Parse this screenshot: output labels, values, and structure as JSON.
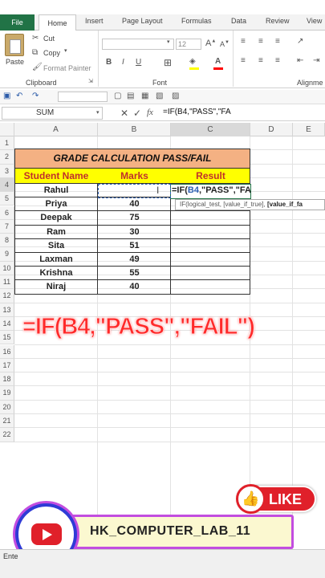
{
  "ribbon": {
    "tabs": [
      "File",
      "Home",
      "Insert",
      "Page Layout",
      "Formulas",
      "Data",
      "Review",
      "View"
    ],
    "clipboard": {
      "cut": "Cut",
      "copy": "Copy",
      "format_painter": "Format Painter",
      "paste": "Paste",
      "group": "Clipboard"
    },
    "font": {
      "size": "12",
      "group": "Font"
    },
    "alignment_group": "Alignme"
  },
  "formula_bar": {
    "name_box": "SUM",
    "fx": "fx",
    "formula": "=IF(B4,\"PASS\",\"FA"
  },
  "columns": [
    "A",
    "B",
    "C",
    "D",
    "E"
  ],
  "rows": [
    "1",
    "2",
    "3",
    "4",
    "5",
    "6",
    "7",
    "8",
    "9",
    "10",
    "11",
    "12",
    "13",
    "14",
    "15",
    "16",
    "17",
    "18",
    "19",
    "20",
    "21",
    "22"
  ],
  "sheet": {
    "title": "GRADE CALCULATION PASS/FAIL",
    "headers": {
      "name": "Student Name",
      "marks": "Marks",
      "result": "Result"
    },
    "students": [
      {
        "name": "Rahul",
        "marks": ""
      },
      {
        "name": "Priya",
        "marks": "40"
      },
      {
        "name": "Deepak",
        "marks": "75"
      },
      {
        "name": "Ram",
        "marks": "30"
      },
      {
        "name": "Sita",
        "marks": "51"
      },
      {
        "name": "Laxman",
        "marks": "49"
      },
      {
        "name": "Krishna",
        "marks": "55"
      },
      {
        "name": "Niraj",
        "marks": "40"
      }
    ],
    "editing_cell": {
      "prefix": "=IF(",
      "ref": "B4",
      "suffix": ",\"PASS\",\"FA"
    },
    "tooltip": {
      "text": "IF(logical_test, [value_if_true], ",
      "bold": "[value_if_fa"
    }
  },
  "overlay": {
    "formula_caption": "=IF(B4,\"PASS\",\"FAIL\")",
    "like": "LIKE",
    "channel": "HK_COMPUTER_LAB_11"
  },
  "status_bar": {
    "mode": "Ente"
  },
  "colors": {
    "excel_green": "#217346",
    "title_fill": "#f4b183",
    "header_fill": "#ffff00",
    "formula_red": "#ff2a2a",
    "like_red": "#e0202a"
  }
}
